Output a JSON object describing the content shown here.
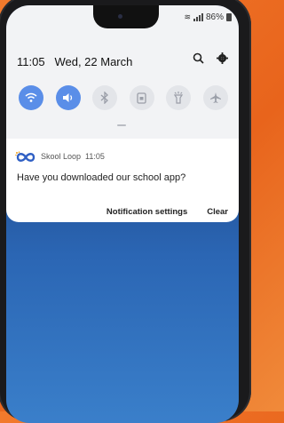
{
  "status_bar": {
    "battery": "86%",
    "battery_icon": "battery-icon",
    "signal_icon": "signal-icon",
    "wifi_icon": "wifi-icon"
  },
  "shade": {
    "time": "11:05",
    "date": "Wed, 22 March",
    "search_icon": "search-icon",
    "settings_icon": "gear-icon"
  },
  "quick_settings": [
    {
      "name": "wifi",
      "icon": "wifi-icon",
      "state": "on"
    },
    {
      "name": "sound",
      "icon": "speaker-icon",
      "state": "on"
    },
    {
      "name": "bluetooth",
      "icon": "bluetooth-icon",
      "state": "off"
    },
    {
      "name": "portrait",
      "icon": "portrait-lock-icon",
      "state": "off"
    },
    {
      "name": "flashlight",
      "icon": "flashlight-icon",
      "state": "off"
    },
    {
      "name": "airplane",
      "icon": "airplane-icon",
      "state": "off"
    }
  ],
  "notification": {
    "app_name": "Skool Loop",
    "time": "11:05",
    "message": "Have you downloaded our school app?",
    "action_settings": "Notification settings",
    "action_clear": "Clear"
  },
  "colors": {
    "background_orange": "#e8641c",
    "qs_active": "#5a8ee8",
    "wallpaper_top": "#102556",
    "wallpaper_bottom": "#3a7fca"
  }
}
